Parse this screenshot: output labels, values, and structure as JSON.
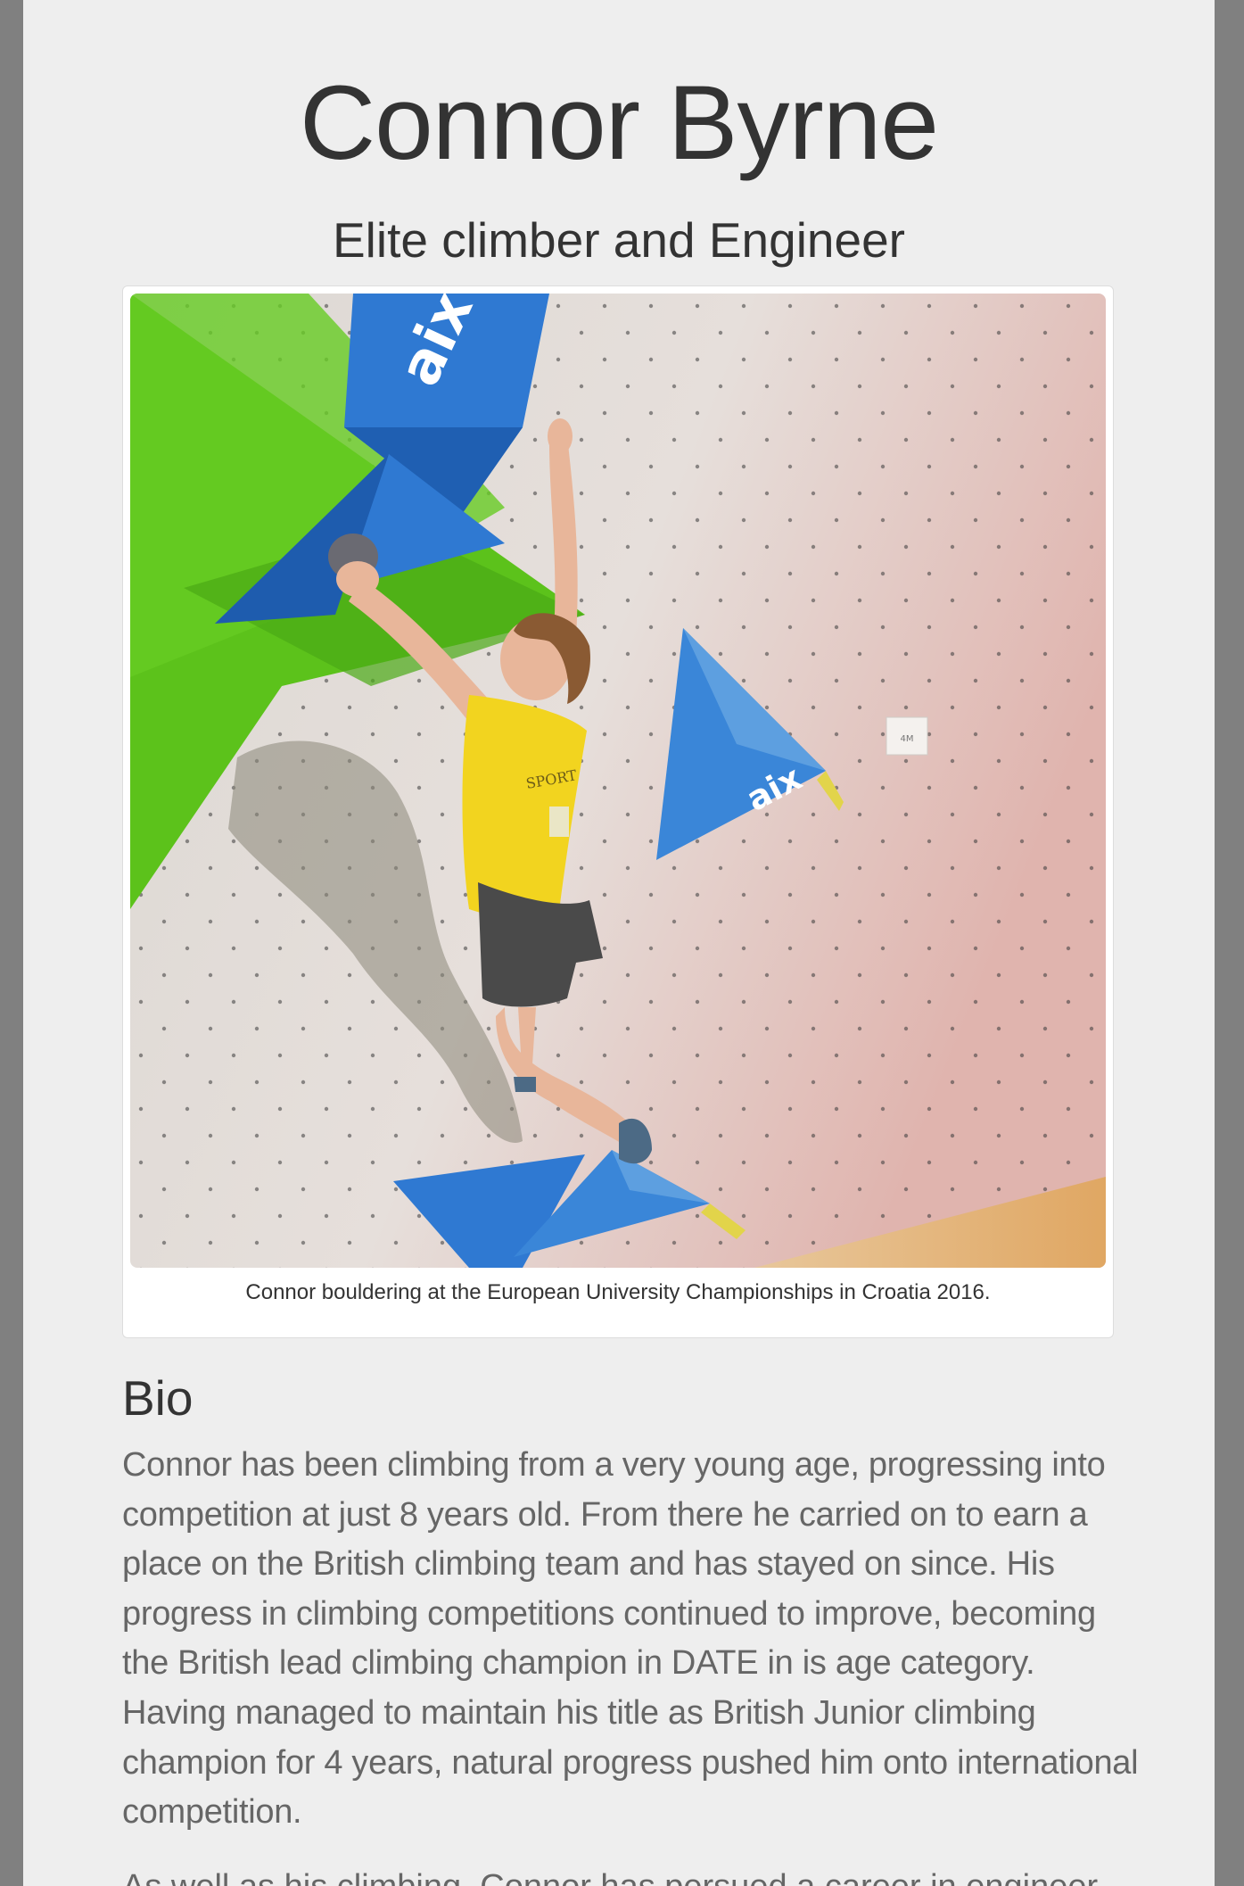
{
  "header": {
    "name": "Connor Byrne",
    "tagline": "Elite climber and Engineer"
  },
  "figure": {
    "caption": "Connor bouldering at the European University Championships in Croatia 2016.",
    "photo_alt": "Climber in yellow vest bouldering on a wall with blue and green volumes",
    "hold_text": "aix",
    "wall_tag": "4M"
  },
  "bio": {
    "heading": "Bio",
    "paragraph_1": "Connor has been climbing from a very young age, progressing into competition at just 8 years old. From there he carried on to earn a place on the British climbing team and has stayed on since. His progress in climbing competitions continued to improve, becoming the British lead climbing champion in DATE in is age category. Having managed to maintain his title as British Junior climbing champion for 4 years, natural progress pushed him onto international competition.",
    "paragraph_2": "As well as his climbing, Connor has persued a career in engineer"
  },
  "colors": {
    "outer_background": "#808080",
    "page_background": "#eeeeee",
    "heading_text": "#333333",
    "body_text": "#666666",
    "vest_yellow": "#f2d41f",
    "hold_blue": "#2f79d2",
    "volume_green": "#5cc21b"
  }
}
